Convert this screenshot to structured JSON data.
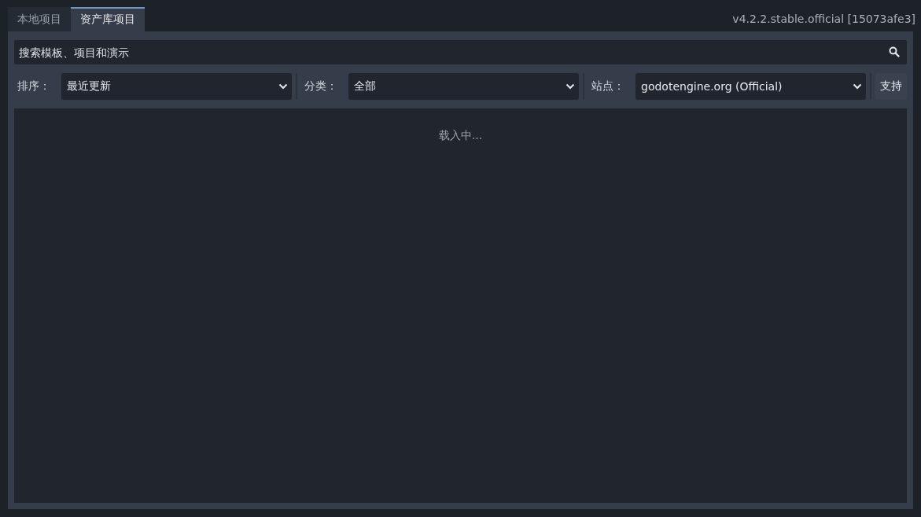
{
  "tabs": [
    {
      "label": "本地项目",
      "selected": false
    },
    {
      "label": "资产库项目",
      "selected": true
    }
  ],
  "version": "v4.2.2.stable.official [15073afe3]",
  "search": {
    "placeholder": "搜索模板、项目和演示"
  },
  "filters": [
    {
      "label": "排序：",
      "value": "最近更新"
    },
    {
      "label": "分类：",
      "value": "全部"
    },
    {
      "label": "站点：",
      "value": "godotengine.org (Official)"
    }
  ],
  "support_button": "支持",
  "status": "载入中..."
}
